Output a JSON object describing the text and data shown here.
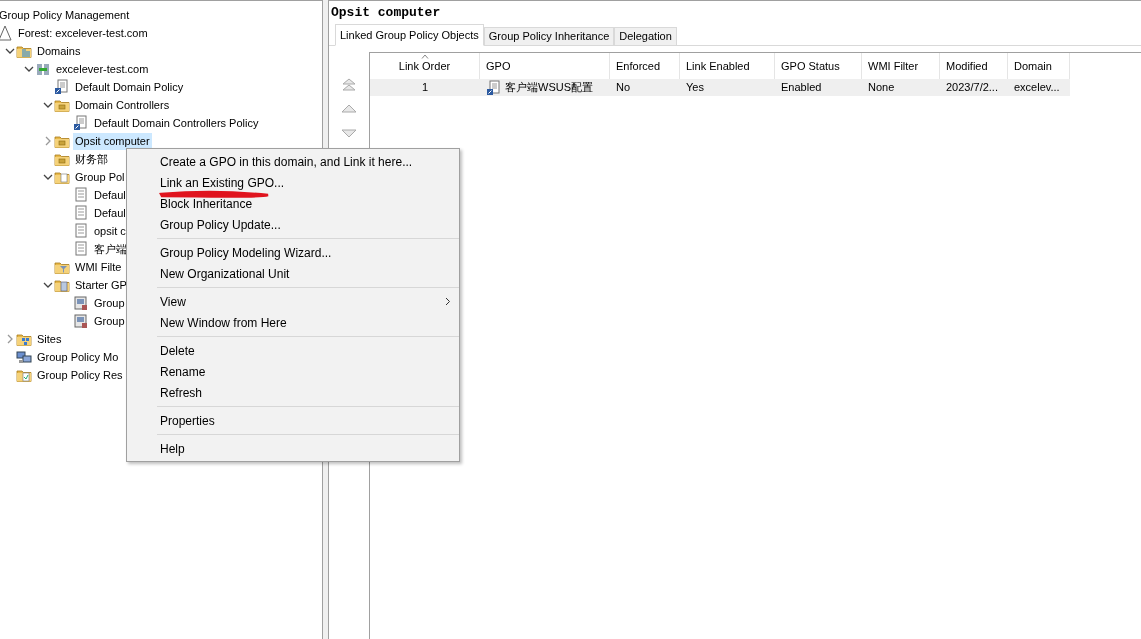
{
  "tree": [
    {
      "label": "Group Policy Management",
      "kind": "root",
      "selected": false,
      "children": [
        {
          "label": "Forest: excelever-test.com",
          "kind": "forest",
          "selected": false,
          "children": [
            {
              "label": "Domains",
              "kind": "domains",
              "expanded": true,
              "selected": false,
              "children": [
                {
                  "label": "excelever-test.com",
                  "kind": "domain",
                  "expanded": true,
                  "selected": false,
                  "children": [
                    {
                      "label": "Default Domain Policy",
                      "kind": "gpo_link",
                      "selected": false
                    },
                    {
                      "label": "Domain Controllers",
                      "kind": "ou",
                      "expanded": true,
                      "selected": false,
                      "children": [
                        {
                          "label": "Default Domain Controllers Policy",
                          "kind": "gpo_link",
                          "selected": false
                        }
                      ]
                    },
                    {
                      "label": "Opsit computer",
                      "kind": "ou",
                      "expanded": false,
                      "selected": true
                    },
                    {
                      "label": "财务部",
                      "kind": "ou",
                      "selected": false
                    },
                    {
                      "label": "Group Pol",
                      "kind": "gpo_folder",
                      "expanded": true,
                      "selected": false,
                      "children": [
                        {
                          "label": "Defaul",
                          "kind": "gpo",
                          "selected": false
                        },
                        {
                          "label": "Defaul",
                          "kind": "gpo",
                          "selected": false
                        },
                        {
                          "label": "opsit c",
                          "kind": "gpo",
                          "selected": false
                        },
                        {
                          "label": "客户端",
                          "kind": "gpo",
                          "selected": false
                        }
                      ]
                    },
                    {
                      "label": "WMI Filte",
                      "kind": "wmi",
                      "selected": false
                    },
                    {
                      "label": "Starter GP",
                      "kind": "starter",
                      "expanded": true,
                      "selected": false,
                      "children": [
                        {
                          "label": "Group",
                          "kind": "starter_gpo",
                          "selected": false
                        },
                        {
                          "label": "Group",
                          "kind": "starter_gpo",
                          "selected": false
                        }
                      ]
                    }
                  ]
                }
              ]
            },
            {
              "label": "Sites",
              "kind": "sites",
              "expanded": false,
              "selected": false
            },
            {
              "label": "Group Policy Mo",
              "kind": "modeling",
              "selected": false
            },
            {
              "label": "Group Policy Res",
              "kind": "results",
              "selected": false
            }
          ]
        }
      ]
    }
  ],
  "details": {
    "title": "Opsit computer",
    "tabs": [
      {
        "label": "Linked Group Policy Objects",
        "selected": true
      },
      {
        "label": "Group Policy Inheritance",
        "selected": false
      },
      {
        "label": "Delegation",
        "selected": false
      }
    ],
    "table": {
      "columns": [
        {
          "label": "Link Order",
          "sorted": true
        },
        {
          "label": "GPO",
          "sorted": false
        },
        {
          "label": "Enforced",
          "sorted": false
        },
        {
          "label": "Link Enabled",
          "sorted": false
        },
        {
          "label": "GPO Status",
          "sorted": false
        },
        {
          "label": "WMI Filter",
          "sorted": false
        },
        {
          "label": "Modified",
          "sorted": false
        },
        {
          "label": "Domain",
          "sorted": false
        }
      ],
      "rows": [
        {
          "selected": true,
          "cells": [
            "1",
            "客户端WSUS配置",
            "No",
            "Yes",
            "Enabled",
            "None",
            "2023/7/2...",
            "excelev..."
          ]
        }
      ]
    }
  },
  "context_menu": {
    "groups": [
      [
        {
          "label": "Create a GPO in this domain, and Link it here...",
          "has_submenu": false
        },
        {
          "label": "Link an Existing GPO...",
          "has_submenu": false
        },
        {
          "label": "Block Inheritance",
          "has_submenu": false
        },
        {
          "label": "Group Policy Update...",
          "has_submenu": false
        }
      ],
      [
        {
          "label": "Group Policy Modeling Wizard...",
          "has_submenu": false
        },
        {
          "label": "New Organizational Unit",
          "has_submenu": false
        }
      ],
      [
        {
          "label": "View",
          "has_submenu": true
        },
        {
          "label": "New Window from Here",
          "has_submenu": false
        }
      ],
      [
        {
          "label": "Delete",
          "has_submenu": false
        },
        {
          "label": "Rename",
          "has_submenu": false
        },
        {
          "label": "Refresh",
          "has_submenu": false
        }
      ],
      [
        {
          "label": "Properties",
          "has_submenu": false
        }
      ],
      [
        {
          "label": "Help",
          "has_submenu": false
        }
      ]
    ]
  }
}
